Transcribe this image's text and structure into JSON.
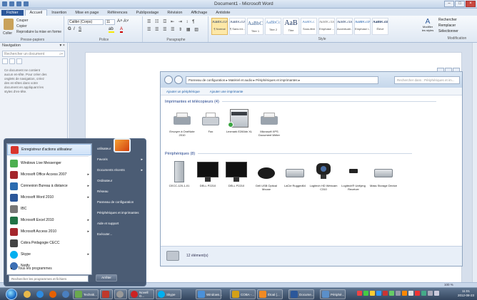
{
  "word": {
    "title": "Document1 - Microsoft Word",
    "tabs": [
      "Fichier",
      "Accueil",
      "Insertion",
      "Mise en page",
      "Références",
      "Publipostage",
      "Révision",
      "Affichage",
      "Antidote"
    ],
    "ribbon": {
      "clipboard": {
        "paste": "Coller",
        "cut": "Couper",
        "copy": "Copier",
        "format_painter": "Reproduire la mise en forme",
        "label": "Presse-papiers"
      },
      "font": {
        "name": "Calibri (Corps)",
        "size": "11",
        "label": "Police"
      },
      "paragraph": {
        "label": "Paragraphe"
      },
      "styles": {
        "items": [
          {
            "sample": "AaBbCcDc",
            "name": "¶ Normal"
          },
          {
            "sample": "AaBbCcDc",
            "name": "¶ Sans int..."
          },
          {
            "sample": "AaBbC",
            "name": "Titre 1"
          },
          {
            "sample": "AaBbCc",
            "name": "Titre 2"
          },
          {
            "sample": "AaB",
            "name": "Titre"
          },
          {
            "sample": "AaBbCc.",
            "name": "Sous-titre"
          },
          {
            "sample": "AaBbCcDc",
            "name": "Emphase ..."
          },
          {
            "sample": "AaBbCcDc",
            "name": "Accentuati..."
          },
          {
            "sample": "AaBbCcDc",
            "name": "Emphase i..."
          },
          {
            "sample": "AaBbCcDc",
            "name": "Élevé"
          }
        ],
        "change": "Modifier les styles",
        "label": "Style"
      },
      "editing": {
        "find": "Rechercher",
        "replace": "Remplacer",
        "select": "Sélectionner",
        "label": "Modification"
      }
    },
    "status_zoom": "100 %"
  },
  "nav": {
    "title": "Navigation",
    "search_placeholder": "Rechercher un document",
    "help": "Ce document ne contient aucun en-tête. Pour créer des onglets de navigation, créez des en-têtes dans votre document en appliquant les styles d'en-tête."
  },
  "explorer": {
    "address": "Panneau de configuration ▸ Matériel et audio ▸ Périphériques et imprimantes ▸",
    "search_placeholder": "Rechercher dans : Périphériques et im...",
    "cmd": [
      "Ajouter un périphérique",
      "Ajouter une imprimante"
    ],
    "printers_header": "Imprimantes et télécopieurs (4)",
    "printers": [
      {
        "label": "Envoyer à OneNote 2010"
      },
      {
        "label": "Fax"
      },
      {
        "label": "Lexmark E260dn XL"
      },
      {
        "label": "Microsoft XPS Document Writer"
      }
    ],
    "devices_header": "Périphériques (8)",
    "devices": [
      {
        "label": "CECC-120-1-01"
      },
      {
        "label": "DELL P2210"
      },
      {
        "label": "DELL P2210"
      },
      {
        "label": "Dell USB Optical Mouse"
      },
      {
        "label": "LaCie Rugged64"
      },
      {
        "label": "Logitech HD Webcam C310"
      },
      {
        "label": "Logitech® Unifying Receiver"
      },
      {
        "label": "Mass Storage Device"
      }
    ],
    "details": "12 élément(s)"
  },
  "startmenu": {
    "left_items": [
      {
        "label": "Enregistreur d'actions utilisateur",
        "color": "#d9352b",
        "arrow": ""
      },
      {
        "label": "Windows Live Messenger",
        "color": "#4caf50",
        "arrow": ""
      },
      {
        "label": "Microsoft Office Access 2007",
        "color": "#a4262c",
        "arrow": "▸"
      },
      {
        "label": "Connexion Bureau à distance",
        "color": "#2b6cb0",
        "arrow": "▸"
      },
      {
        "label": "Microsoft Word 2010",
        "color": "#2b579a",
        "arrow": "▸"
      },
      {
        "label": "IBC",
        "color": "#777777",
        "arrow": ""
      },
      {
        "label": "Microsoft Excel 2010",
        "color": "#217346",
        "arrow": "▸"
      },
      {
        "label": "Microsoft Access 2010",
        "color": "#a4262c",
        "arrow": "▸"
      },
      {
        "label": "Cobra Pédagogie CECC",
        "color": "#444444",
        "arrow": ""
      },
      {
        "label": "Skype",
        "color": "#00aff0",
        "arrow": "▸"
      },
      {
        "label": "Notify",
        "color": "#3c6fb4",
        "arrow": ""
      }
    ],
    "all_programs": "Tous les programmes",
    "search_placeholder": "Rechercher les programmes et fichiers",
    "right_items": [
      {
        "label": "utilisateur",
        "arrow": ""
      },
      {
        "label": "Favoris",
        "arrow": "▸"
      },
      {
        "label": "Documents récents",
        "arrow": "▸"
      },
      {
        "label": "Ordinateur",
        "arrow": ""
      },
      {
        "label": "Réseau",
        "arrow": ""
      },
      {
        "label": "Panneau de configuration",
        "arrow": ""
      },
      {
        "label": "Périphériques et imprimantes",
        "arrow": ""
      },
      {
        "label": "Aide et support",
        "arrow": ""
      },
      {
        "label": "Exécuter...",
        "arrow": ""
      }
    ],
    "shutdown": "Arrêter"
  },
  "taskbar": {
    "pinned": [
      {
        "name": "explorer-pinned-icon",
        "color": "#e8b84a"
      },
      {
        "name": "ie-pinned-icon",
        "color": "#2f8be0"
      },
      {
        "name": "firefox-pinned-icon",
        "color": "#e66000"
      },
      {
        "name": "media-pinned-icon",
        "color": "#4a7fbf"
      }
    ],
    "windows": [
      {
        "label": "Techniti...",
        "color": "#6aa84f"
      },
      {
        "label": "",
        "color": "#c0392b"
      },
      {
        "label": "",
        "color": "#999999"
      },
      {
        "label": "Novell G...",
        "color": "#cc2222"
      },
      {
        "label": "Skype",
        "color": "#00aff0"
      },
      {
        "label": "Windows...",
        "color": "#4a90d9"
      },
      {
        "label": "COBA -...",
        "color": "#d4a017"
      },
      {
        "label": "Étoal (...",
        "color": "#f08a24"
      },
      {
        "label": "Docume...",
        "color": "#2b579a"
      },
      {
        "label": "Périphé...",
        "color": "#5b8fc9"
      }
    ],
    "time": "11:01",
    "date": "2012-08-23"
  }
}
